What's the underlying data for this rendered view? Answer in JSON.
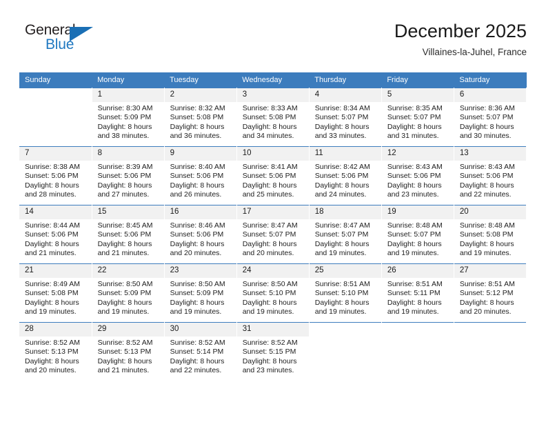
{
  "brand": {
    "name_top": "General",
    "name_bottom": "Blue",
    "accent_color": "#2079c1",
    "triangle_color": "#1a6fb5",
    "text_color": "#231f20"
  },
  "header": {
    "title": "December 2025",
    "subtitle": "Villaines-la-Juhel, France"
  },
  "calendar": {
    "header_bg": "#3c7cbd",
    "daynum_bg": "#f1f1f1",
    "weekdays": [
      "Sunday",
      "Monday",
      "Tuesday",
      "Wednesday",
      "Thursday",
      "Friday",
      "Saturday"
    ],
    "weeks": [
      [
        {
          "empty": true,
          "day": "",
          "sunrise": "",
          "sunset": "",
          "daylight_line1": "",
          "daylight_line2": ""
        },
        {
          "empty": false,
          "day": "1",
          "sunrise": "Sunrise: 8:30 AM",
          "sunset": "Sunset: 5:09 PM",
          "daylight_line1": "Daylight: 8 hours",
          "daylight_line2": "and 38 minutes."
        },
        {
          "empty": false,
          "day": "2",
          "sunrise": "Sunrise: 8:32 AM",
          "sunset": "Sunset: 5:08 PM",
          "daylight_line1": "Daylight: 8 hours",
          "daylight_line2": "and 36 minutes."
        },
        {
          "empty": false,
          "day": "3",
          "sunrise": "Sunrise: 8:33 AM",
          "sunset": "Sunset: 5:08 PM",
          "daylight_line1": "Daylight: 8 hours",
          "daylight_line2": "and 34 minutes."
        },
        {
          "empty": false,
          "day": "4",
          "sunrise": "Sunrise: 8:34 AM",
          "sunset": "Sunset: 5:07 PM",
          "daylight_line1": "Daylight: 8 hours",
          "daylight_line2": "and 33 minutes."
        },
        {
          "empty": false,
          "day": "5",
          "sunrise": "Sunrise: 8:35 AM",
          "sunset": "Sunset: 5:07 PM",
          "daylight_line1": "Daylight: 8 hours",
          "daylight_line2": "and 31 minutes."
        },
        {
          "empty": false,
          "day": "6",
          "sunrise": "Sunrise: 8:36 AM",
          "sunset": "Sunset: 5:07 PM",
          "daylight_line1": "Daylight: 8 hours",
          "daylight_line2": "and 30 minutes."
        }
      ],
      [
        {
          "empty": false,
          "day": "7",
          "sunrise": "Sunrise: 8:38 AM",
          "sunset": "Sunset: 5:06 PM",
          "daylight_line1": "Daylight: 8 hours",
          "daylight_line2": "and 28 minutes."
        },
        {
          "empty": false,
          "day": "8",
          "sunrise": "Sunrise: 8:39 AM",
          "sunset": "Sunset: 5:06 PM",
          "daylight_line1": "Daylight: 8 hours",
          "daylight_line2": "and 27 minutes."
        },
        {
          "empty": false,
          "day": "9",
          "sunrise": "Sunrise: 8:40 AM",
          "sunset": "Sunset: 5:06 PM",
          "daylight_line1": "Daylight: 8 hours",
          "daylight_line2": "and 26 minutes."
        },
        {
          "empty": false,
          "day": "10",
          "sunrise": "Sunrise: 8:41 AM",
          "sunset": "Sunset: 5:06 PM",
          "daylight_line1": "Daylight: 8 hours",
          "daylight_line2": "and 25 minutes."
        },
        {
          "empty": false,
          "day": "11",
          "sunrise": "Sunrise: 8:42 AM",
          "sunset": "Sunset: 5:06 PM",
          "daylight_line1": "Daylight: 8 hours",
          "daylight_line2": "and 24 minutes."
        },
        {
          "empty": false,
          "day": "12",
          "sunrise": "Sunrise: 8:43 AM",
          "sunset": "Sunset: 5:06 PM",
          "daylight_line1": "Daylight: 8 hours",
          "daylight_line2": "and 23 minutes."
        },
        {
          "empty": false,
          "day": "13",
          "sunrise": "Sunrise: 8:43 AM",
          "sunset": "Sunset: 5:06 PM",
          "daylight_line1": "Daylight: 8 hours",
          "daylight_line2": "and 22 minutes."
        }
      ],
      [
        {
          "empty": false,
          "day": "14",
          "sunrise": "Sunrise: 8:44 AM",
          "sunset": "Sunset: 5:06 PM",
          "daylight_line1": "Daylight: 8 hours",
          "daylight_line2": "and 21 minutes."
        },
        {
          "empty": false,
          "day": "15",
          "sunrise": "Sunrise: 8:45 AM",
          "sunset": "Sunset: 5:06 PM",
          "daylight_line1": "Daylight: 8 hours",
          "daylight_line2": "and 21 minutes."
        },
        {
          "empty": false,
          "day": "16",
          "sunrise": "Sunrise: 8:46 AM",
          "sunset": "Sunset: 5:06 PM",
          "daylight_line1": "Daylight: 8 hours",
          "daylight_line2": "and 20 minutes."
        },
        {
          "empty": false,
          "day": "17",
          "sunrise": "Sunrise: 8:47 AM",
          "sunset": "Sunset: 5:07 PM",
          "daylight_line1": "Daylight: 8 hours",
          "daylight_line2": "and 20 minutes."
        },
        {
          "empty": false,
          "day": "18",
          "sunrise": "Sunrise: 8:47 AM",
          "sunset": "Sunset: 5:07 PM",
          "daylight_line1": "Daylight: 8 hours",
          "daylight_line2": "and 19 minutes."
        },
        {
          "empty": false,
          "day": "19",
          "sunrise": "Sunrise: 8:48 AM",
          "sunset": "Sunset: 5:07 PM",
          "daylight_line1": "Daylight: 8 hours",
          "daylight_line2": "and 19 minutes."
        },
        {
          "empty": false,
          "day": "20",
          "sunrise": "Sunrise: 8:48 AM",
          "sunset": "Sunset: 5:08 PM",
          "daylight_line1": "Daylight: 8 hours",
          "daylight_line2": "and 19 minutes."
        }
      ],
      [
        {
          "empty": false,
          "day": "21",
          "sunrise": "Sunrise: 8:49 AM",
          "sunset": "Sunset: 5:08 PM",
          "daylight_line1": "Daylight: 8 hours",
          "daylight_line2": "and 19 minutes."
        },
        {
          "empty": false,
          "day": "22",
          "sunrise": "Sunrise: 8:50 AM",
          "sunset": "Sunset: 5:09 PM",
          "daylight_line1": "Daylight: 8 hours",
          "daylight_line2": "and 19 minutes."
        },
        {
          "empty": false,
          "day": "23",
          "sunrise": "Sunrise: 8:50 AM",
          "sunset": "Sunset: 5:09 PM",
          "daylight_line1": "Daylight: 8 hours",
          "daylight_line2": "and 19 minutes."
        },
        {
          "empty": false,
          "day": "24",
          "sunrise": "Sunrise: 8:50 AM",
          "sunset": "Sunset: 5:10 PM",
          "daylight_line1": "Daylight: 8 hours",
          "daylight_line2": "and 19 minutes."
        },
        {
          "empty": false,
          "day": "25",
          "sunrise": "Sunrise: 8:51 AM",
          "sunset": "Sunset: 5:10 PM",
          "daylight_line1": "Daylight: 8 hours",
          "daylight_line2": "and 19 minutes."
        },
        {
          "empty": false,
          "day": "26",
          "sunrise": "Sunrise: 8:51 AM",
          "sunset": "Sunset: 5:11 PM",
          "daylight_line1": "Daylight: 8 hours",
          "daylight_line2": "and 19 minutes."
        },
        {
          "empty": false,
          "day": "27",
          "sunrise": "Sunrise: 8:51 AM",
          "sunset": "Sunset: 5:12 PM",
          "daylight_line1": "Daylight: 8 hours",
          "daylight_line2": "and 20 minutes."
        }
      ],
      [
        {
          "empty": false,
          "day": "28",
          "sunrise": "Sunrise: 8:52 AM",
          "sunset": "Sunset: 5:13 PM",
          "daylight_line1": "Daylight: 8 hours",
          "daylight_line2": "and 20 minutes."
        },
        {
          "empty": false,
          "day": "29",
          "sunrise": "Sunrise: 8:52 AM",
          "sunset": "Sunset: 5:13 PM",
          "daylight_line1": "Daylight: 8 hours",
          "daylight_line2": "and 21 minutes."
        },
        {
          "empty": false,
          "day": "30",
          "sunrise": "Sunrise: 8:52 AM",
          "sunset": "Sunset: 5:14 PM",
          "daylight_line1": "Daylight: 8 hours",
          "daylight_line2": "and 22 minutes."
        },
        {
          "empty": false,
          "day": "31",
          "sunrise": "Sunrise: 8:52 AM",
          "sunset": "Sunset: 5:15 PM",
          "daylight_line1": "Daylight: 8 hours",
          "daylight_line2": "and 23 minutes."
        },
        {
          "empty": true,
          "day": "",
          "sunrise": "",
          "sunset": "",
          "daylight_line1": "",
          "daylight_line2": ""
        },
        {
          "empty": true,
          "day": "",
          "sunrise": "",
          "sunset": "",
          "daylight_line1": "",
          "daylight_line2": ""
        },
        {
          "empty": true,
          "day": "",
          "sunrise": "",
          "sunset": "",
          "daylight_line1": "",
          "daylight_line2": ""
        }
      ]
    ]
  }
}
